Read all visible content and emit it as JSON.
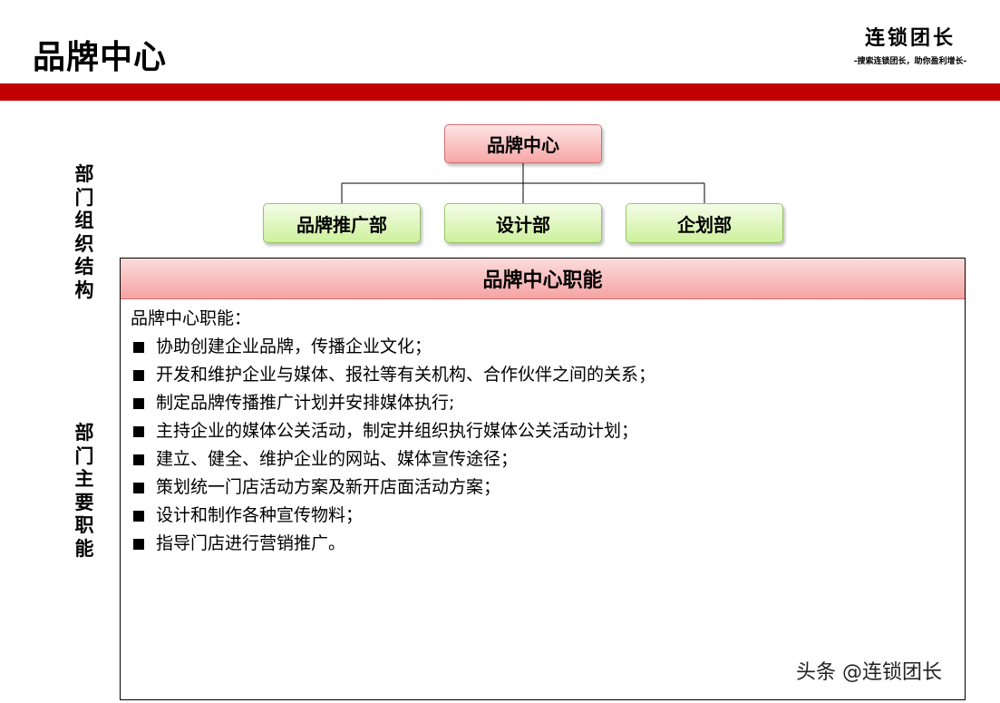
{
  "header": {
    "title": "品牌中心",
    "logo_main": "连锁团长",
    "logo_sub": "-搜索连锁团长，助你盈利增长-"
  },
  "side_labels": {
    "org_structure": "部门组织结构",
    "main_duties": "部门主要职能"
  },
  "org_chart": {
    "root": "品牌中心",
    "children": [
      "品牌推广部",
      "设计部",
      "企划部"
    ]
  },
  "duties_panel": {
    "heading": "品牌中心职能",
    "intro": "品牌中心职能：",
    "items": [
      "协助创建企业品牌，传播企业文化；",
      "开发和维护企业与媒体、报社等有关机构、合作伙伴之间的关系；",
      "制定品牌传播推广计划并安排媒体执行;",
      "主持企业的媒体公关活动，制定并组织执行媒体公关活动计划；",
      "建立、健全、维护企业的网站、媒体宣传途径；",
      "策划统一门店活动方案及新开店面活动方案；",
      "设计和制作各种宣传物料；",
      "指导门店进行营销推广。"
    ]
  },
  "watermark": "头条 @连锁团长",
  "colors": {
    "brand_red": "#c00000",
    "root_box": "#f7a7a7",
    "child_box": "#cdf09b"
  }
}
